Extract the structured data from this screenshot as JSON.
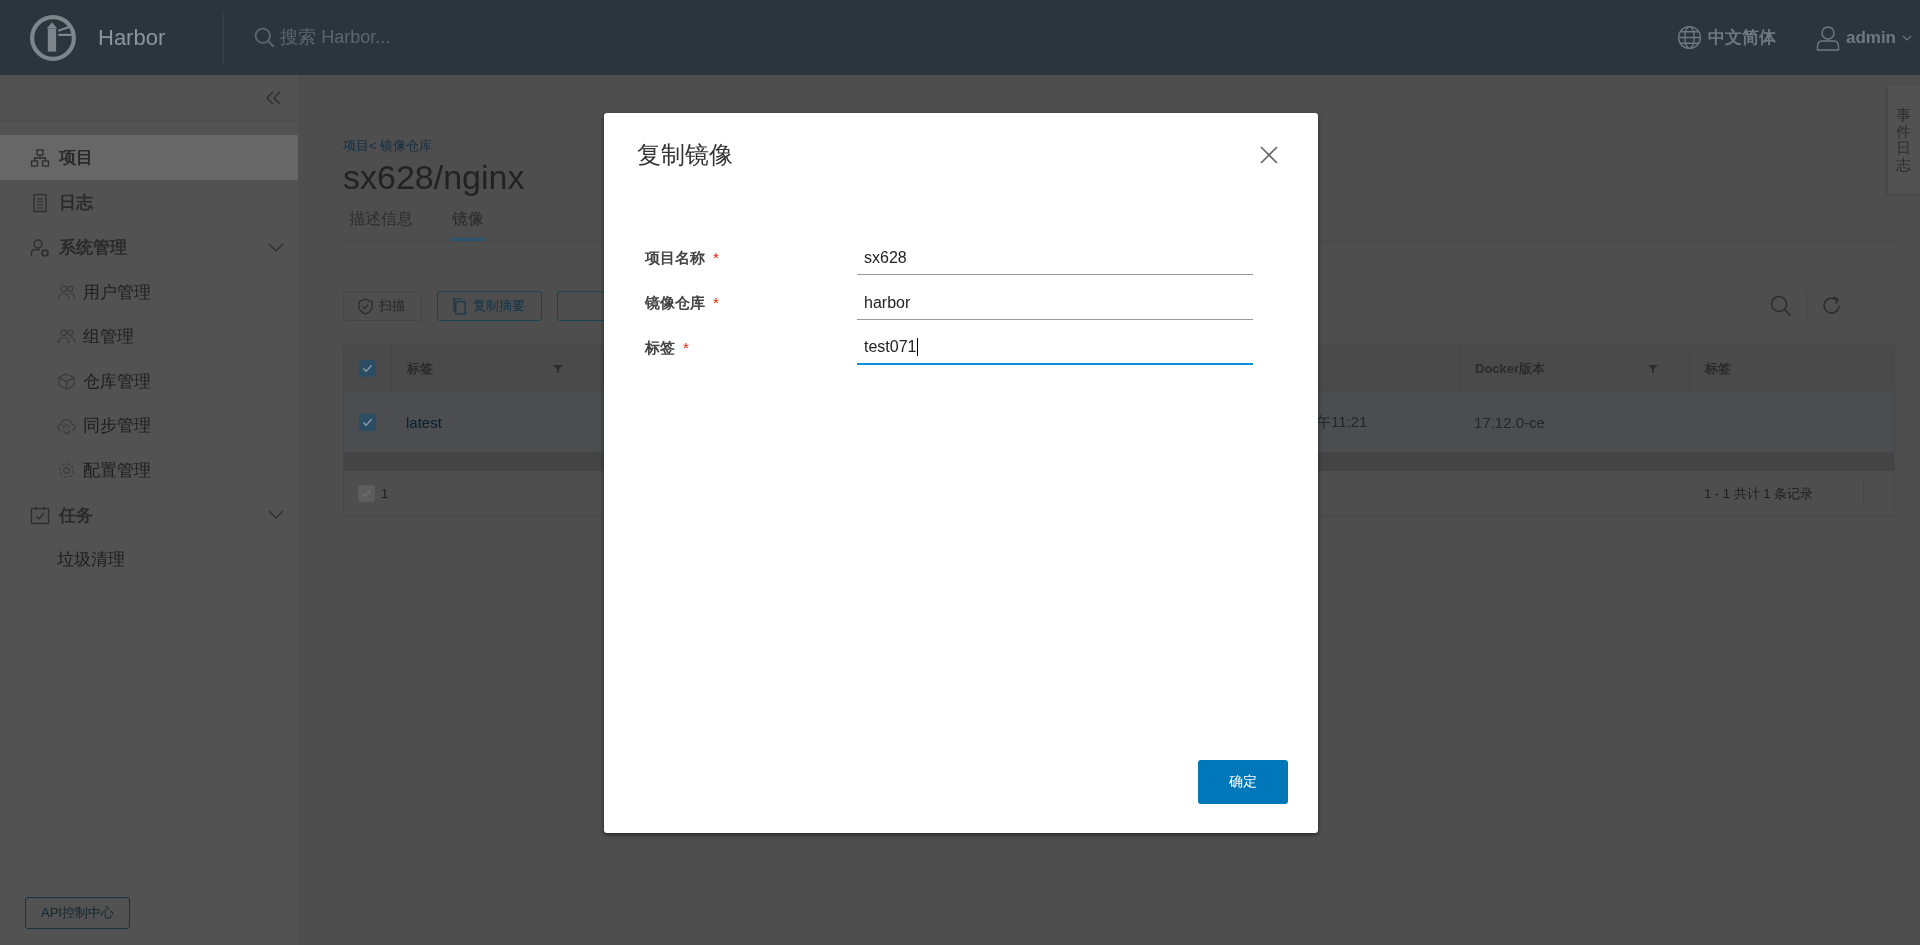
{
  "header": {
    "brand": "Harbor",
    "search": {
      "placeholder": "搜索 Harbor..."
    },
    "language": "中文简体",
    "user": "admin"
  },
  "sidebar": {
    "items": [
      {
        "label": "项目",
        "selected": true
      },
      {
        "label": "日志",
        "selected": false
      },
      {
        "label": "系统管理",
        "selected": false,
        "expanded": true,
        "children": [
          {
            "label": "用户管理",
            "selected": false
          },
          {
            "label": "组管理",
            "selected": false
          },
          {
            "label": "仓库管理",
            "selected": false
          },
          {
            "label": "同步管理",
            "selected": false
          },
          {
            "label": "配置管理",
            "selected": false
          }
        ]
      },
      {
        "label": "任务",
        "selected": false,
        "expanded": true,
        "children": [
          {
            "label": "垃圾清理",
            "selected": false
          }
        ]
      }
    ],
    "api_button": "API控制中心"
  },
  "breadcrumb": "项目< 镜像仓库",
  "title": "sx628/nginx",
  "tabs": [
    {
      "label": "描述信息",
      "selected": false
    },
    {
      "label": "镜像",
      "selected": true
    }
  ],
  "toolbar": {
    "buttons": [
      {
        "label": "扫描",
        "disabled": true
      },
      {
        "label": "复制摘要",
        "disabled": false
      },
      {
        "disabled": false
      }
    ]
  },
  "table": {
    "header_checked": true,
    "columns": [
      {
        "label": "标签",
        "filter": true
      },
      {
        "label": "Docker版本",
        "filter": true
      },
      {
        "label": "标签",
        "filter": false
      }
    ],
    "rows": [
      {
        "selected": true,
        "tag": "latest",
        "created": "午11:21",
        "docker_version": "17.12.0-ce"
      }
    ],
    "footer": {
      "checked": true,
      "selected_count": "1",
      "summary": "1 - 1 共计 1 条记录"
    }
  },
  "side_tab": "事件日志",
  "modal": {
    "title": "复制镜像",
    "fields": [
      {
        "label": "项目名称",
        "required_mark": "*",
        "value": "sx628",
        "focused": false
      },
      {
        "label": "镜像仓库",
        "required_mark": "*",
        "value": "harbor",
        "focused": false
      },
      {
        "label": "标签",
        "required_mark": "*",
        "value": "test071",
        "focused": true
      }
    ],
    "confirm": "确定"
  }
}
